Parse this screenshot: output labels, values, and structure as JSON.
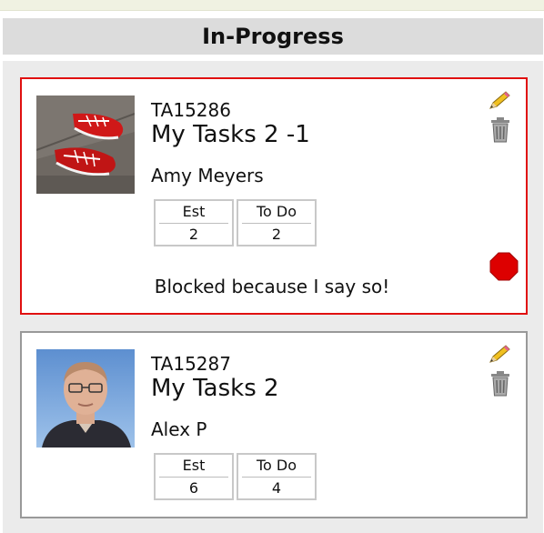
{
  "column": {
    "title": "In-Progress"
  },
  "cards": [
    {
      "id": "TA15286",
      "title": "My Tasks 2 -1",
      "owner": "Amy Meyers",
      "est_label": "Est",
      "est_value": "2",
      "todo_label": "To Do",
      "todo_value": "2",
      "blocked": true,
      "blocked_reason": "Blocked because I say so!",
      "avatar_icon": "red-sneakers-photo"
    },
    {
      "id": "TA15287",
      "title": "My Tasks 2",
      "owner": "Alex P",
      "est_label": "Est",
      "est_value": "6",
      "todo_label": "To Do",
      "todo_value": "4",
      "blocked": false,
      "avatar_icon": "man-portrait-photo"
    }
  ],
  "colors": {
    "blocked_border": "#e01010",
    "normal_border": "#999999",
    "stop_sign": "#dd0000"
  }
}
